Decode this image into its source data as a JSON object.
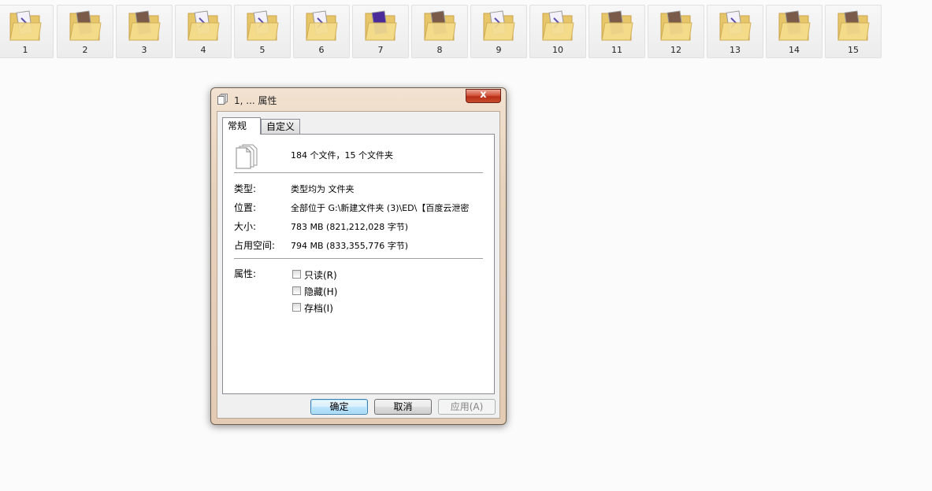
{
  "folders": [
    {
      "label": "1",
      "thumb": "mp4"
    },
    {
      "label": "2",
      "thumb": "photo"
    },
    {
      "label": "3",
      "thumb": "photo"
    },
    {
      "label": "4",
      "thumb": "mp4"
    },
    {
      "label": "5",
      "thumb": "mp4"
    },
    {
      "label": "6",
      "thumb": "mp4"
    },
    {
      "label": "7",
      "thumb": "purple"
    },
    {
      "label": "8",
      "thumb": "photo"
    },
    {
      "label": "9",
      "thumb": "mp4"
    },
    {
      "label": "10",
      "thumb": "mp4"
    },
    {
      "label": "11",
      "thumb": "photo"
    },
    {
      "label": "12",
      "thumb": "photo"
    },
    {
      "label": "13",
      "thumb": "mp4"
    },
    {
      "label": "14",
      "thumb": "photo"
    },
    {
      "label": "15",
      "thumb": "photo"
    }
  ],
  "dialog": {
    "title": "1, ... 属性",
    "close_glyph": "x",
    "tabs": {
      "general": "常规",
      "custom": "自定义"
    },
    "summary": "184 个文件，15 个文件夹",
    "props": {
      "type_label": "类型:",
      "type_value": "类型均为 文件夹",
      "location_label": "位置:",
      "location_value": "全部位于 G:\\新建文件夹 (3)\\ED\\【百度云泄密",
      "size_label": "大小:",
      "size_value": "783 MB (821,212,028 字节)",
      "disk_label": "占用空间:",
      "disk_value": "794 MB (833,355,776 字节)",
      "attr_label": "属性:"
    },
    "attributes": {
      "readonly": "只读(R)",
      "hidden": "隐藏(H)",
      "archive": "存档(I)"
    },
    "buttons": {
      "ok": "确定",
      "cancel": "取消",
      "apply": "应用(A)"
    }
  }
}
